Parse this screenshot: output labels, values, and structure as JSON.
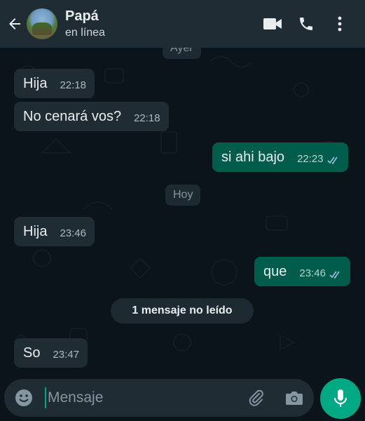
{
  "header": {
    "contact_name": "Papá",
    "status": "en línea",
    "icons": [
      "back-arrow-icon",
      "video-call-icon",
      "phone-icon",
      "more-vertical-icon"
    ]
  },
  "dates": {
    "ayer": "Ayer",
    "hoy": "Hoy"
  },
  "messages": [
    {
      "direction": "in",
      "text": "Hija",
      "time": "22:18"
    },
    {
      "direction": "in",
      "text": "No cenará vos?",
      "time": "22:18"
    },
    {
      "direction": "out",
      "text": "si ahi bajo",
      "time": "22:23",
      "status": "read"
    },
    {
      "direction": "in",
      "text": "Hija",
      "time": "23:46"
    },
    {
      "direction": "out",
      "text": "que",
      "time": "23:46",
      "status": "read"
    },
    {
      "direction": "in",
      "text": "So",
      "time": "23:47"
    }
  ],
  "unread_banner": "1 mensaje no leído",
  "composer": {
    "placeholder": "Mensaje",
    "icons": [
      "emoji-icon",
      "attach-icon",
      "camera-icon",
      "microphone-icon"
    ]
  },
  "colors": {
    "background": "#0b141a",
    "header": "#1f2c34",
    "incoming_bubble": "#1f2c34",
    "outgoing_bubble": "#005c4b",
    "accent": "#00a884",
    "read_ticks": "#53bdeb"
  }
}
